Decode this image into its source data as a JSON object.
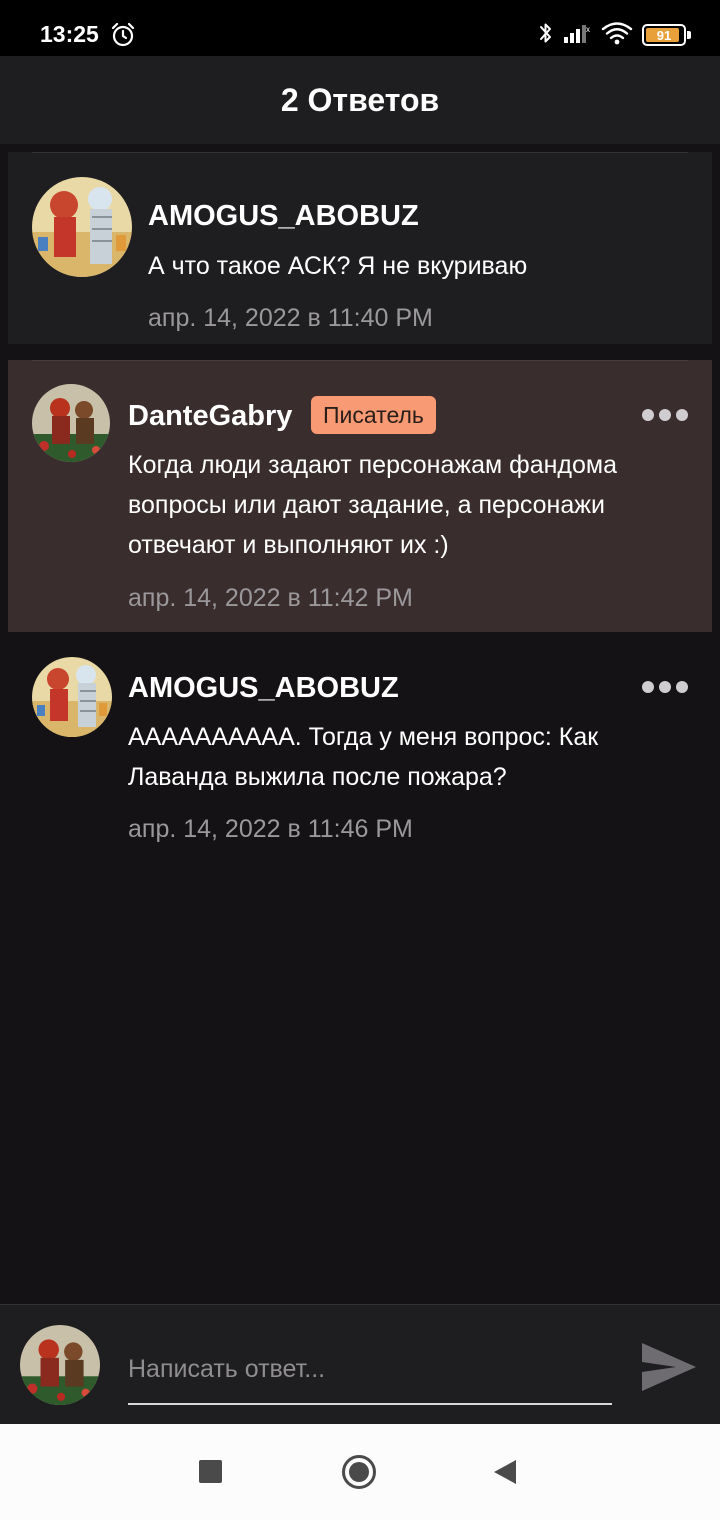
{
  "status_bar": {
    "time": "13:25",
    "battery": "91",
    "battery_level": 0.91,
    "icons": [
      "alarm-icon",
      "bluetooth-icon",
      "signal-icon",
      "wifi-icon",
      "battery-icon"
    ]
  },
  "header": {
    "title": "2 Ответов"
  },
  "comments": [
    {
      "author": "AMOGUS_ABOBUZ",
      "badge": "",
      "text": "А что такое АСК? Я не вкуриваю",
      "timestamp": "апр. 14, 2022 в 11:40 PM",
      "has_menu": false
    },
    {
      "author": "DanteGabry",
      "badge": "Писатель",
      "text": "Когда люди задают персонажам фандома вопросы или дают задание, а персонажи отвечают и выполняют их :)",
      "timestamp": "апр. 14, 2022 в 11:42 PM",
      "has_menu": true
    },
    {
      "author": "AMOGUS_ABOBUZ",
      "badge": "",
      "text": "АААААААААА. Тогда у меня вопрос: Как Лаванда выжила  после пожара?",
      "timestamp": "апр. 14, 2022 в 11:46 PM",
      "has_menu": true
    }
  ],
  "reply": {
    "placeholder": "Написать ответ...",
    "value": ""
  },
  "colors": {
    "background": "#141214",
    "card": "#1e1d20",
    "highlight": "#3a2d2d",
    "badge": "#f89a73",
    "timestamp": "#9a989b"
  }
}
